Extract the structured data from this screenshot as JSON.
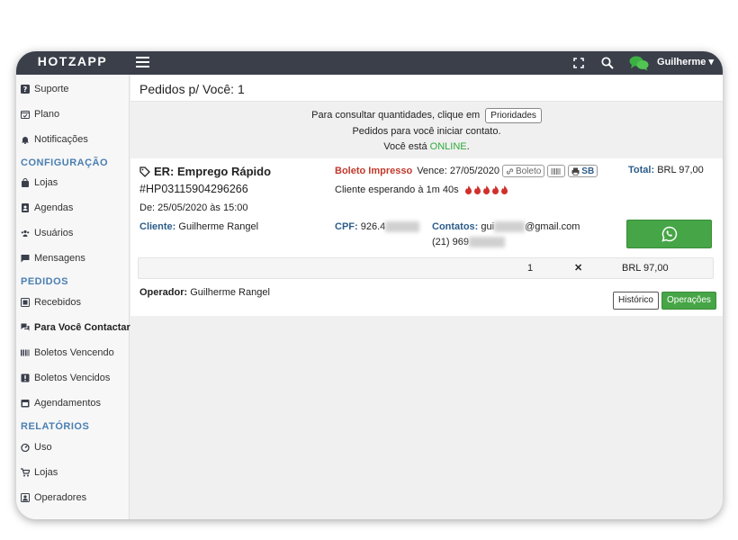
{
  "topbar": {
    "brand": "HOTZAPP",
    "user_name": "Guilherme ▾",
    "accent": "#3a3f4a"
  },
  "sidebar": {
    "items": [
      {
        "label": "Suporte",
        "icon": "question-icon"
      },
      {
        "label": "Plano",
        "icon": "calendar-check-icon"
      },
      {
        "label": "Notificações",
        "icon": "bell-icon"
      },
      {
        "label": "Lojas",
        "icon": "shopping-bag-icon"
      },
      {
        "label": "Agendas",
        "icon": "address-book-icon"
      },
      {
        "label": "Usuários",
        "icon": "users-icon"
      },
      {
        "label": "Mensagens",
        "icon": "comment-icon"
      },
      {
        "label": "Recebidos",
        "icon": "inbox-icon"
      },
      {
        "label": "Para Você Contactar",
        "icon": "comments-icon"
      },
      {
        "label": "Boletos Vencendo",
        "icon": "barcode-icon"
      },
      {
        "label": "Boletos Vencidos",
        "icon": "exclamation-icon"
      },
      {
        "label": "Agendamentos",
        "icon": "calendar-icon"
      },
      {
        "label": "Uso",
        "icon": "dashboard-icon"
      },
      {
        "label": "Lojas",
        "icon": "cart-icon"
      },
      {
        "label": "Operadores",
        "icon": "operators-icon"
      }
    ],
    "headings": [
      "CONFIGURAÇÃO",
      "PEDIDOS",
      "RELATÓRIOS"
    ]
  },
  "main": {
    "title": "Pedidos p/ Você: 1",
    "info_line1": "Para consultar quantidades, clique em",
    "priorities_button": "Prioridades",
    "info_line2": "Pedidos para você iniciar contato.",
    "online_prefix": "Você está",
    "online_status": "ONLINE",
    "online_suffix": "."
  },
  "order": {
    "product": "ER: Emprego Rápido",
    "code": "#HP03115904296266",
    "date": "De: 25/05/2020 às 15:00",
    "payment_status": "Boleto Impresso",
    "due": "Vence: 27/05/2020",
    "boleto_button": "Boleto",
    "sb_button": "SB",
    "waiting": "Cliente esperando à 1m 40s",
    "total_label": "Total:",
    "total_value": "BRL 97,00",
    "client_label": "Cliente:",
    "client_name": "Guilherme Rangel",
    "cpf_label": "CPF:",
    "cpf_value": "926.4",
    "contacts_label": "Contatos:",
    "email_prefix": "gui",
    "email_suffix": "@gmail.com",
    "phone_prefix": "(21) 969",
    "qty": "1",
    "remove_mark": "✕",
    "line_total": "BRL 97,00",
    "operator_label": "Operador:",
    "operator_name": "Guilherme Rangel",
    "history_button": "Histórico",
    "operations_button": "Operações"
  }
}
